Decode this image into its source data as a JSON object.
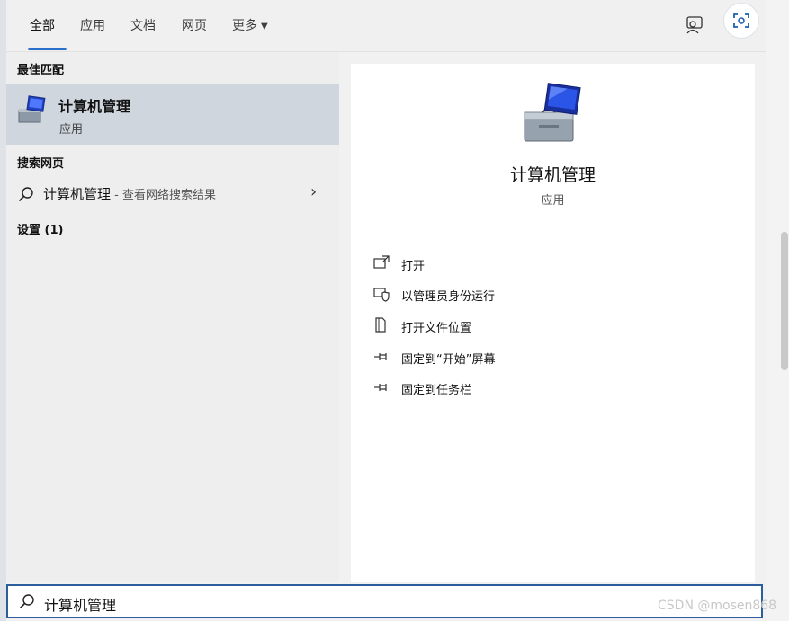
{
  "tabs": [
    {
      "label": "全部",
      "active": true
    },
    {
      "label": "应用"
    },
    {
      "label": "文档"
    },
    {
      "label": "网页"
    },
    {
      "label": "更多"
    }
  ],
  "toolbar": {
    "feedback_icon": "feedback-person-icon",
    "scan_icon": "screen-scan-icon"
  },
  "left": {
    "best_match_heading": "最佳匹配",
    "best_match": {
      "title": "计算机管理",
      "subtitle": "应用",
      "icon": "computer-management-icon"
    },
    "web_heading": "搜索网页",
    "web_result": {
      "query": "计算机管理",
      "suffix": " - 查看网络搜索结果"
    },
    "settings_heading": "设置 (1)"
  },
  "detail": {
    "title": "计算机管理",
    "subtitle": "应用",
    "actions": [
      {
        "label": "打开",
        "icon": "open-icon"
      },
      {
        "label": "以管理员身份运行",
        "icon": "run-as-admin-shield-icon"
      },
      {
        "label": "打开文件位置",
        "icon": "file-location-icon"
      },
      {
        "label": "固定到“开始”屏幕",
        "icon": "pin-icon"
      },
      {
        "label": "固定到任务栏",
        "icon": "pin-icon"
      }
    ]
  },
  "search": {
    "value": "计算机管理",
    "icon": "search-icon"
  },
  "watermark": "CSDN @mosen868",
  "colors": {
    "accent": "#2a6fc9",
    "selected_row": "#cfd6de",
    "search_border": "#2c5e9e"
  }
}
